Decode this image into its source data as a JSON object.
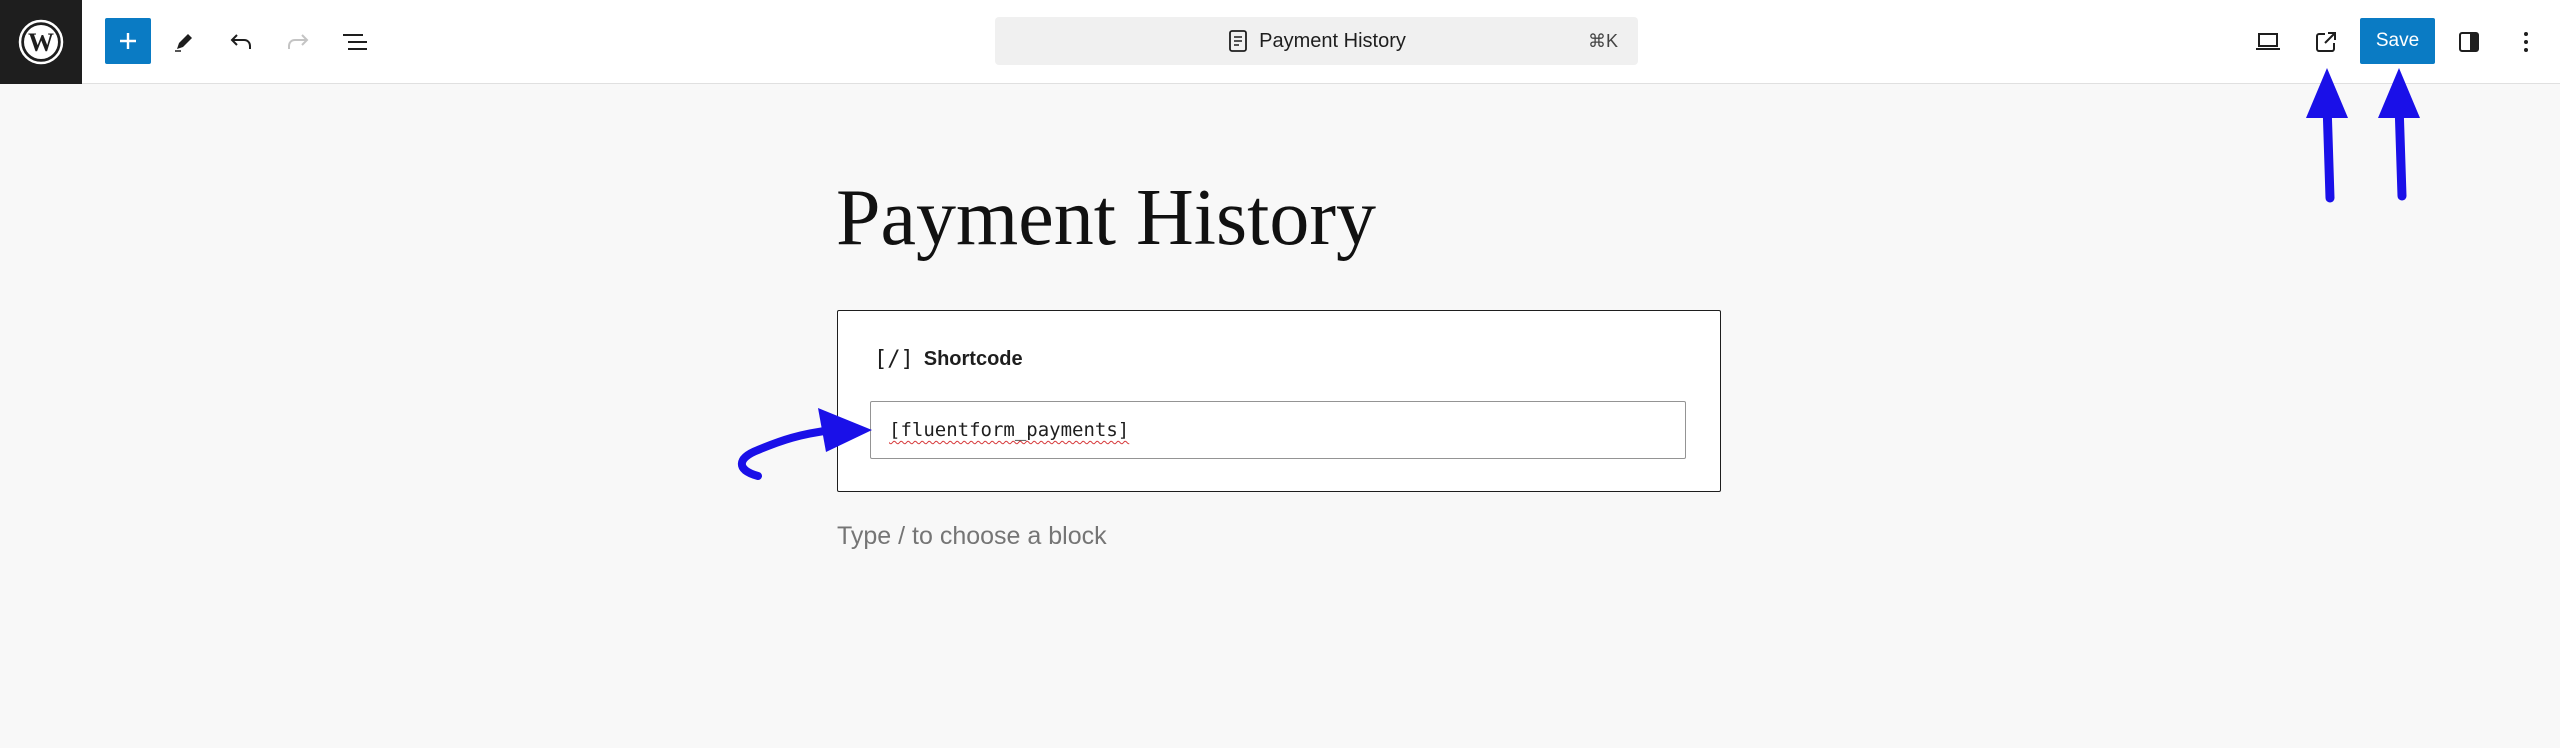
{
  "toolbar": {
    "save_label": "Save",
    "document_title": "Payment History",
    "command_shortcut": "⌘K"
  },
  "editor": {
    "post_title": "Payment History",
    "shortcode_block": {
      "icon_text": "[/]",
      "label": "Shortcode",
      "value": "[fluentform_payments]"
    },
    "appender_placeholder": "Type / to choose a block"
  },
  "colors": {
    "accent": "#0a7bc4",
    "annotation": "#1a10e8"
  },
  "icons": [
    "wordpress-logo-icon",
    "plus-icon",
    "pencil-icon",
    "undo-icon",
    "redo-icon",
    "list-view-icon",
    "document-icon",
    "preview-device-icon",
    "external-link-icon",
    "sidebar-toggle-icon",
    "more-options-icon"
  ]
}
